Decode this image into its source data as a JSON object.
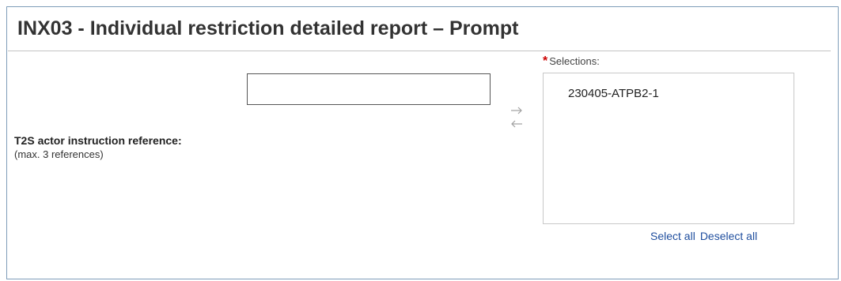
{
  "page": {
    "title": "INX03 - Individual restriction detailed report – Prompt"
  },
  "field": {
    "label": "T2S actor instruction reference:",
    "hint": "(max. 3 references)",
    "input_value": "",
    "input_placeholder": ""
  },
  "controls": {
    "add_icon": "arrow-right-icon",
    "remove_icon": "arrow-left-icon"
  },
  "selections": {
    "required_marker": "*",
    "label": "Selections:",
    "items": [
      "230405-ATPB2-1"
    ],
    "select_all_label": "Select all",
    "deselect_all_label": "Deselect all"
  },
  "colors": {
    "required": "#cc0000",
    "link": "#1f4e9e",
    "arrow": "#a0a0a0",
    "frame_border": "#7f9db9"
  }
}
